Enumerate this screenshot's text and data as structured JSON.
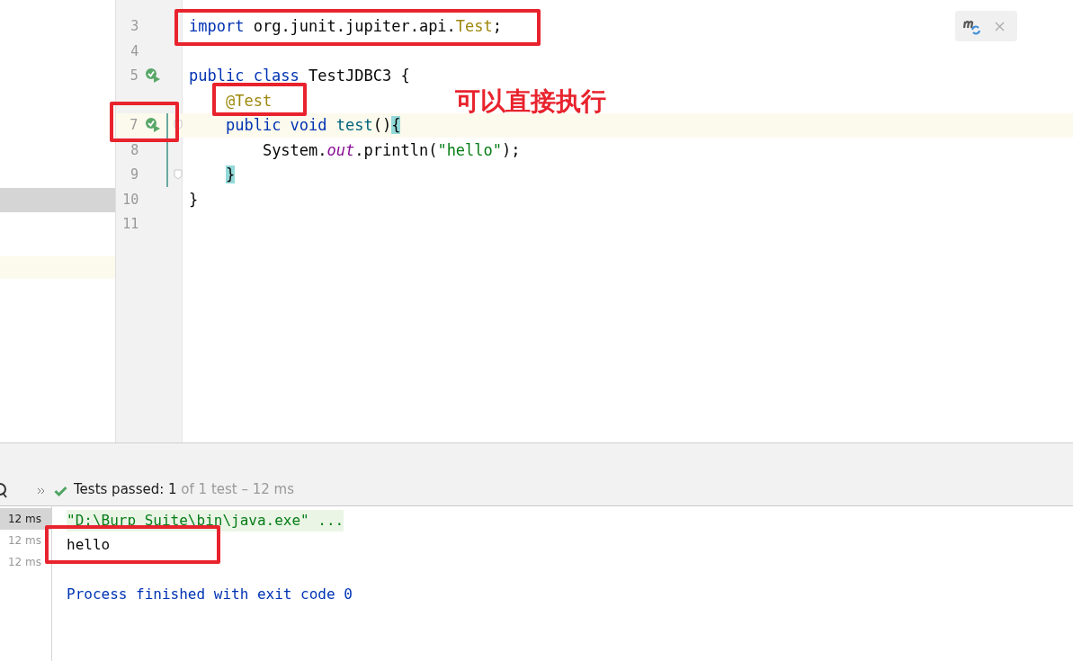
{
  "project_tree": {
    "rows": [
      {
        "selected": true
      },
      {
        "selected": false
      }
    ]
  },
  "editor": {
    "lines": [
      {
        "run": false,
        "current": false,
        "changed": false,
        "fold": false
      },
      {
        "number": "3",
        "run": false,
        "current": false,
        "changed": false,
        "fold": false,
        "tokens": [
          {
            "kind": "keyword",
            "text": "import"
          },
          {
            "kind": "plain",
            "text": " org.junit.jupiter.api."
          },
          {
            "kind": "type",
            "text": "Test"
          },
          {
            "kind": "plain",
            "text": ";"
          }
        ]
      },
      {
        "number": "4",
        "run": false,
        "current": false,
        "changed": false,
        "fold": false
      },
      {
        "number": "5",
        "run": true,
        "current": false,
        "changed": false,
        "fold": false,
        "tokens": [
          {
            "kind": "keyword",
            "text": "public class"
          },
          {
            "kind": "plain",
            "text": " TestJDBC3 {"
          }
        ]
      },
      {
        "run": false,
        "current": false,
        "changed": false,
        "fold": false,
        "tokens": [
          {
            "kind": "annotation",
            "text": "    @Test"
          }
        ]
      },
      {
        "number": "7",
        "run": true,
        "current": true,
        "changed": true,
        "fold": true,
        "tokens": [
          {
            "kind": "keyword",
            "text": "    public void"
          },
          {
            "kind": "method",
            "text": " test"
          },
          {
            "kind": "plain",
            "text": "()"
          },
          {
            "kind": "brace",
            "text": "{"
          }
        ]
      },
      {
        "number": "8",
        "run": false,
        "current": false,
        "changed": true,
        "fold": false,
        "tokens": [
          {
            "kind": "plain",
            "text": "        System."
          },
          {
            "kind": "static",
            "text": "out"
          },
          {
            "kind": "plain",
            "text": ".println("
          },
          {
            "kind": "string",
            "text": "\"hello\""
          },
          {
            "kind": "plain",
            "text": ");"
          }
        ]
      },
      {
        "number": "9",
        "run": false,
        "current": false,
        "changed": true,
        "fold": true,
        "tokens": [
          {
            "kind": "brace",
            "text": "    }"
          }
        ]
      },
      {
        "number": "10",
        "run": false,
        "current": false,
        "changed": false,
        "fold": false,
        "tokens": [
          {
            "kind": "plain",
            "text": "}"
          }
        ]
      },
      {
        "number": "11",
        "run": false,
        "current": false,
        "changed": false,
        "fold": false
      }
    ]
  },
  "callout": "可以直接执行",
  "test_panel": {
    "status": "Tests passed: 1",
    "detail": " of 1 test – 12 ms",
    "durations": [
      {
        "text": "12 ms",
        "selected": true
      },
      {
        "text": "12 ms",
        "selected": false
      },
      {
        "text": "12 ms",
        "selected": false
      }
    ],
    "console": [
      {
        "kind": "command",
        "text": "\"D:\\Burp Suite\\bin\\java.exe\" ..."
      },
      {
        "kind": "output",
        "text": "hello"
      },
      {
        "kind": "blank"
      },
      {
        "kind": "system",
        "text": "Process finished with exit code 0"
      }
    ]
  }
}
